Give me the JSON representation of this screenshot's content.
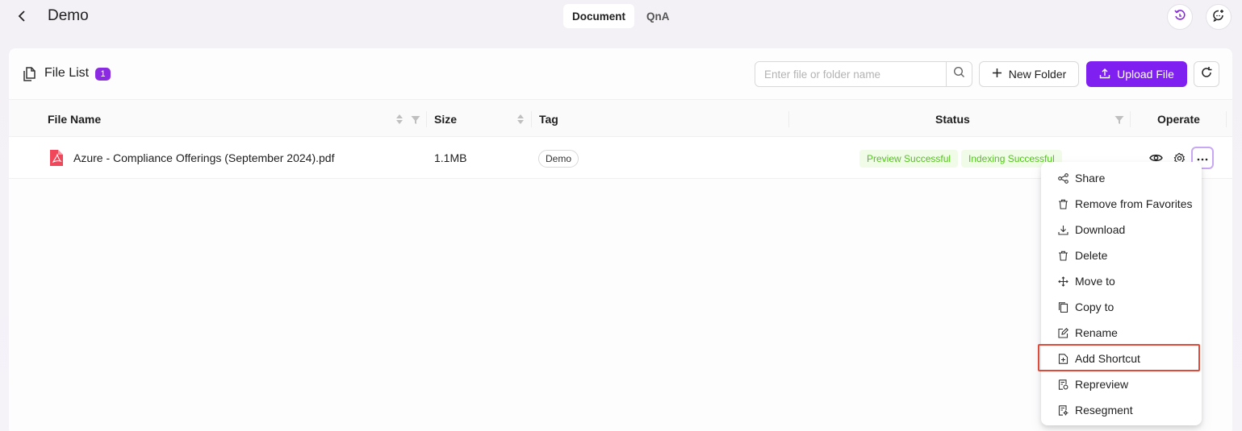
{
  "header": {
    "title": "Demo",
    "tabs": [
      {
        "label": "Document",
        "active": true
      },
      {
        "label": "QnA",
        "active": false
      }
    ]
  },
  "panel": {
    "title": "File List",
    "count": "1",
    "search_placeholder": "Enter file or folder name",
    "new_folder_label": "New Folder",
    "upload_label": "Upload File"
  },
  "table": {
    "columns": {
      "file_name": "File Name",
      "size": "Size",
      "tag": "Tag",
      "status": "Status",
      "operate": "Operate"
    },
    "rows": [
      {
        "file_name": "Azure - Compliance Offerings (September 2024).pdf",
        "size": "1.1MB",
        "tag": "Demo",
        "status_preview": "Preview Successful",
        "status_index": "Indexing Successful"
      }
    ]
  },
  "context_menu": {
    "items": [
      {
        "label": "Share",
        "icon": "share-icon"
      },
      {
        "label": "Remove from Favorites",
        "icon": "trash-icon"
      },
      {
        "label": "Download",
        "icon": "download-icon"
      },
      {
        "label": "Delete",
        "icon": "trash-icon"
      },
      {
        "label": "Move to",
        "icon": "move-icon"
      },
      {
        "label": "Copy to",
        "icon": "copy-icon"
      },
      {
        "label": "Rename",
        "icon": "edit-icon"
      },
      {
        "label": "Add Shortcut",
        "icon": "add-file-icon"
      },
      {
        "label": "Repreview",
        "icon": "repreview-icon"
      },
      {
        "label": "Resegment",
        "icon": "resegment-icon"
      }
    ],
    "highlighted_item": "Add Shortcut"
  },
  "colors": {
    "accent": "#7f1ff0",
    "badge": "#8a2be2",
    "success": "#52c41a",
    "success_bg": "#f0fce8",
    "highlight": "#e04a3a",
    "pdf_red": "#f0485a"
  }
}
